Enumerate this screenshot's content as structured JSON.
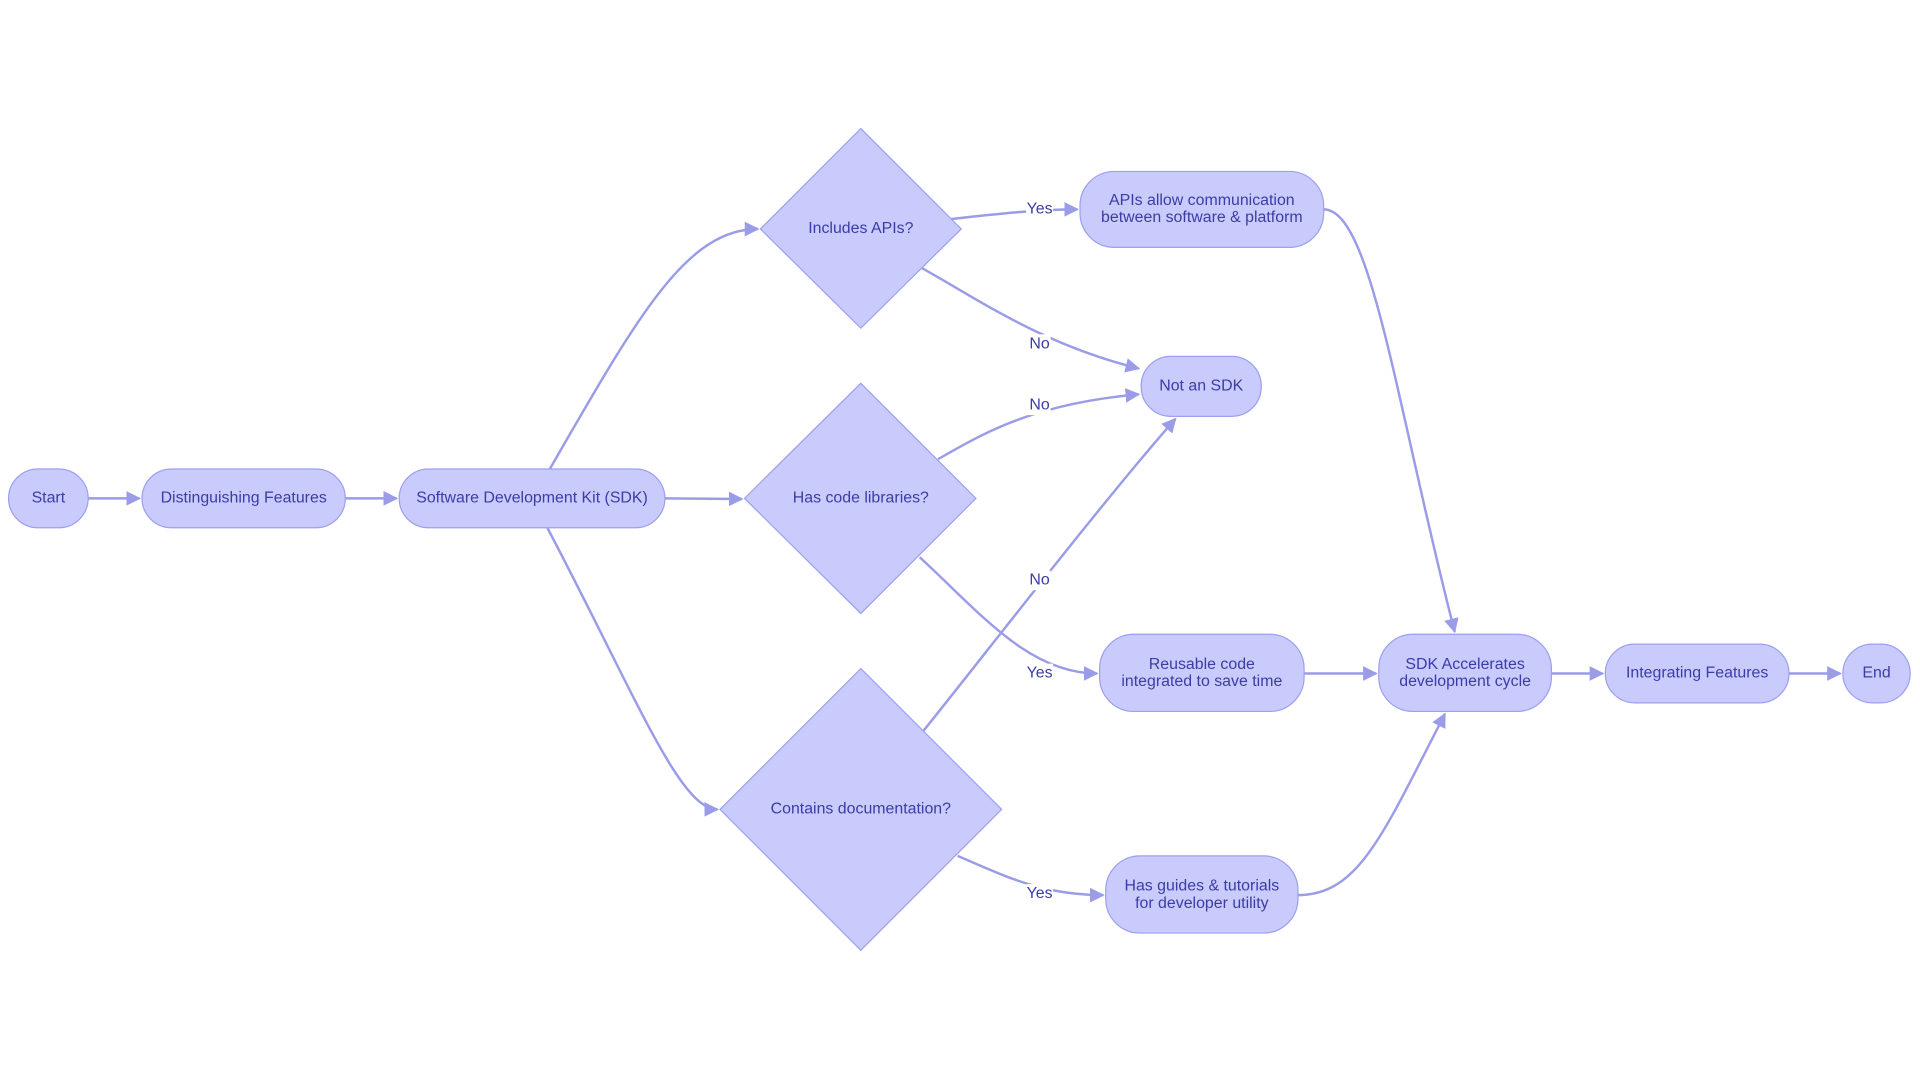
{
  "colors": {
    "node_fill": "#c9cbfd",
    "node_stroke": "#9d9ff0",
    "edge": "#9a9ce8",
    "text": "#3b3ca6"
  },
  "nodes": {
    "start": "Start",
    "features": "Distinguishing Features",
    "sdk": "Software Development Kit (SDK)",
    "apis_q": "Includes APIs?",
    "libs_q": "Has code libraries?",
    "docs_q": "Contains documentation?",
    "apis_yes": [
      "APIs allow communication",
      "between software & platform"
    ],
    "not_sdk": "Not an SDK",
    "libs_yes": [
      "Reusable code",
      "integrated to save time"
    ],
    "docs_yes": [
      "Has guides & tutorials",
      "for developer utility"
    ],
    "accel": [
      "SDK Accelerates",
      "development cycle"
    ],
    "integrating": "Integrating Features",
    "end": "End"
  },
  "edge_labels": {
    "apis_yes": "Yes",
    "apis_no": "No",
    "libs_no": "No",
    "docs_no": "No",
    "libs_yes": "Yes",
    "docs_yes": "Yes"
  }
}
